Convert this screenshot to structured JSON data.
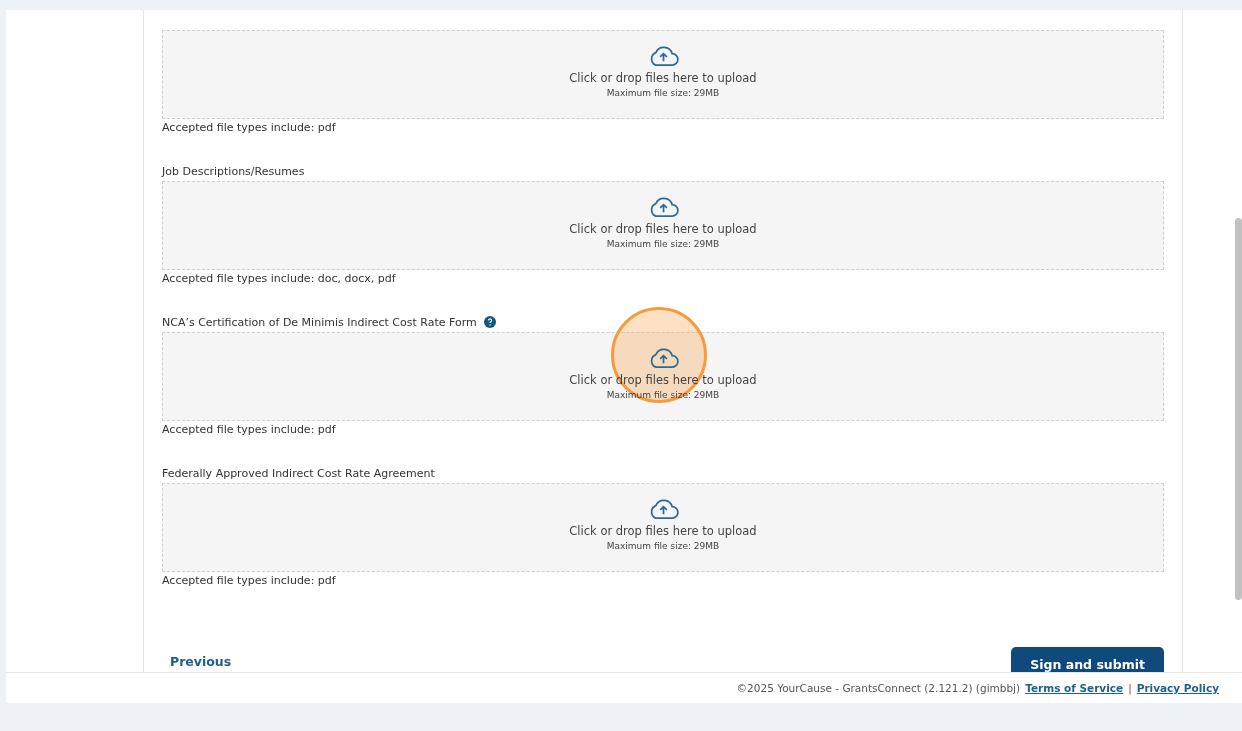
{
  "uploads": [
    {
      "prompt": "Click or drop files here to upload",
      "max_size": "Maximum file size: 29MB",
      "accepted": "Accepted file types include: pdf",
      "help": false,
      "highlighted": false
    },
    {
      "label": "Job Descriptions/Resumes",
      "prompt": "Click or drop files here to upload",
      "max_size": "Maximum file size: 29MB",
      "accepted": "Accepted file types include: doc, docx, pdf",
      "help": false,
      "highlighted": false
    },
    {
      "label": "NCA’s Certification of De Minimis Indirect Cost Rate Form",
      "prompt": "Click or drop files here to upload",
      "max_size": "Maximum file size: 29MB",
      "accepted": "Accepted file types include: pdf",
      "help": true,
      "highlighted": true
    },
    {
      "label": "Federally Approved Indirect Cost Rate Agreement",
      "prompt": "Click or drop files here to upload",
      "max_size": "Maximum file size: 29MB",
      "accepted": "Accepted file types include: pdf",
      "help": false,
      "highlighted": false
    }
  ],
  "previous": "Previous",
  "submit": "Sign and submit",
  "footer": {
    "copyright": "©2025 YourCause - GrantsConnect (2.121.2) (gimbbj)",
    "terms": "Terms of Service",
    "separator": "|",
    "privacy": "Privacy Policy"
  }
}
